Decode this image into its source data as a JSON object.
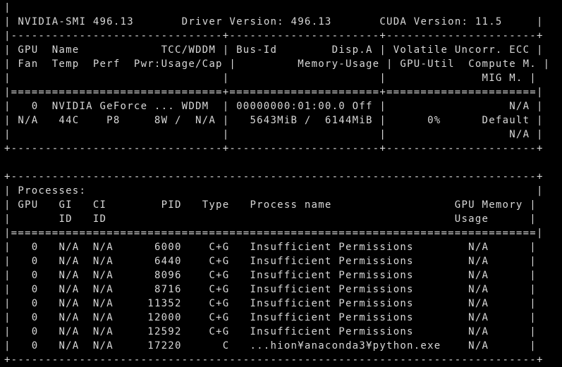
{
  "window": {
    "background": "#000000",
    "foreground": "#d8d8d8"
  },
  "header": {
    "smi_label": "NVIDIA-SMI 496.13",
    "driver_label": "Driver Version: 496.13",
    "cuda_label": "CUDA Version: 11.5"
  },
  "gpu_table": {
    "columns": {
      "row1": {
        "col_a": "GPU  Name            TCC/WDDM",
        "col_b": "Bus-Id        Disp.A",
        "col_c": "Volatile Uncorr. ECC"
      },
      "row2": {
        "col_a": "Fan  Temp  Perf  Pwr:Usage/Cap",
        "col_b": "        Memory-Usage",
        "col_c": "GPU-Util  Compute M."
      },
      "row3": {
        "col_a": "",
        "col_b": "",
        "col_c": "             MIG M."
      }
    },
    "rows": [
      {
        "line1": {
          "col_a": "  0  NVIDIA GeForce ... WDDM",
          "col_b": "00000000:01:00.0 Off",
          "col_c": "                 N/A"
        },
        "line2": {
          "col_a": "N/A   44C    P8     8W /  N/A",
          "col_b": "  5643MiB /  6144MiB",
          "col_c": "     0%      Default"
        },
        "line3": {
          "col_a": "",
          "col_b": "",
          "col_c": "                 N/A"
        }
      }
    ]
  },
  "processes": {
    "title": "Processes:",
    "header1": " GPU   GI   CI        PID   Type   Process name                  GPU Memory ",
    "header2": "       ID   ID                                                   Usage      ",
    "rows": [
      "   0   N/A  N/A      6000    C+G   Insufficient Permissions        N/A      ",
      "   0   N/A  N/A      6440    C+G   Insufficient Permissions        N/A      ",
      "   0   N/A  N/A      8096    C+G   Insufficient Permissions        N/A      ",
      "   0   N/A  N/A      8716    C+G   Insufficient Permissions        N/A      ",
      "   0   N/A  N/A     11352    C+G   Insufficient Permissions        N/A      ",
      "   0   N/A  N/A     12000    C+G   Insufficient Permissions        N/A      ",
      "   0   N/A  N/A     12592    C+G   Insufficient Permissions        N/A      ",
      "   0   N/A  N/A     17220      C   ...hion¥anaconda3¥python.exe    N/A      "
    ]
  }
}
